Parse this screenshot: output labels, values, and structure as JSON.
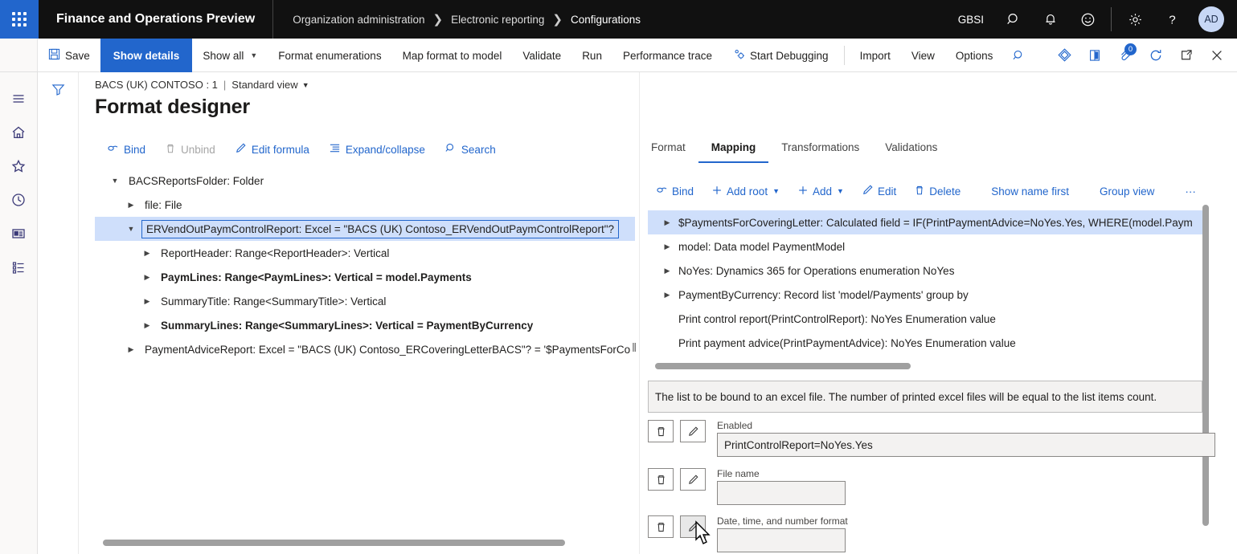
{
  "topbar": {
    "waffle_name": "app-launcher",
    "app_title": "Finance and Operations Preview",
    "breadcrumb": [
      {
        "label": "Organization administration"
      },
      {
        "label": "Electronic reporting"
      },
      {
        "label": "Configurations"
      }
    ],
    "company": "GBSI",
    "icons": [
      {
        "name": "search-icon",
        "glyph": "search"
      },
      {
        "name": "notifications-icon",
        "glyph": "bell"
      },
      {
        "name": "feedback-smiley-icon",
        "glyph": "smiley"
      },
      {
        "name": "settings-gear-icon",
        "glyph": "gear"
      },
      {
        "name": "help-icon",
        "glyph": "question"
      }
    ],
    "avatar_initials": "AD"
  },
  "actionbar": {
    "buttons": [
      {
        "label": "Save",
        "icon": "save-icon",
        "active": false,
        "caret": false
      },
      {
        "label": "Show details",
        "icon": "",
        "active": true,
        "caret": false
      },
      {
        "label": "Show all",
        "icon": "",
        "active": false,
        "caret": true
      },
      {
        "label": "Format enumerations",
        "icon": "",
        "active": false,
        "caret": false
      },
      {
        "label": "Map format to model",
        "icon": "",
        "active": false,
        "caret": false
      },
      {
        "label": "Validate",
        "icon": "",
        "active": false,
        "caret": false
      },
      {
        "label": "Run",
        "icon": "",
        "active": false,
        "caret": false
      },
      {
        "label": "Performance trace",
        "icon": "",
        "active": false,
        "caret": false
      },
      {
        "label": "Start Debugging",
        "icon": "debug-icon",
        "active": false,
        "caret": false
      }
    ],
    "buttons_right_group": [
      {
        "label": "Import"
      },
      {
        "label": "View"
      },
      {
        "label": "Options"
      }
    ],
    "right_icons": [
      {
        "name": "search-icon",
        "glyph": "search"
      },
      {
        "name": "personalize-icon",
        "glyph": "diamond"
      },
      {
        "name": "share-icon",
        "glyph": "book"
      },
      {
        "name": "attachments-icon",
        "glyph": "clip",
        "badge": "0"
      },
      {
        "name": "refresh-icon",
        "glyph": "refresh"
      },
      {
        "name": "open-in-new-window-icon",
        "glyph": "popout"
      },
      {
        "name": "close-icon",
        "glyph": "close"
      }
    ]
  },
  "rail": {
    "items": [
      {
        "name": "hamburger-menu-icon",
        "glyph": "menu"
      },
      {
        "name": "home-icon",
        "glyph": "home"
      },
      {
        "name": "favorites-star-icon",
        "glyph": "star"
      },
      {
        "name": "recent-clock-icon",
        "glyph": "clock"
      },
      {
        "name": "workspaces-icon",
        "glyph": "workspace"
      },
      {
        "name": "modules-list-icon",
        "glyph": "list"
      }
    ],
    "filter_icon": "filter-icon"
  },
  "pagehead": {
    "record": "BACS (UK) CONTOSO : 1",
    "separator": "|",
    "view": "Standard view",
    "title": "Format designer"
  },
  "left_toolbar": [
    {
      "label": "Bind",
      "icon": "bind-link-icon",
      "disabled": false
    },
    {
      "label": "Unbind",
      "icon": "unbind-trash-icon",
      "disabled": true
    },
    {
      "label": "Edit formula",
      "icon": "edit-pencil-icon",
      "disabled": false
    },
    {
      "label": "Expand/collapse",
      "icon": "expand-collapse-icon",
      "disabled": false
    },
    {
      "label": "Search",
      "icon": "search-icon",
      "disabled": false
    }
  ],
  "format_tree": [
    {
      "label": "BACSReportsFolder: Folder",
      "indent": 0,
      "twisty": "expanded",
      "bold": false,
      "selected": false
    },
    {
      "label": "file: File",
      "indent": 1,
      "twisty": "collapsed",
      "bold": false,
      "selected": false
    },
    {
      "label": "ERVendOutPaymControlReport: Excel = \"BACS (UK) Contoso_ERVendOutPaymControlReport\"?",
      "indent": 1,
      "twisty": "expanded",
      "bold": false,
      "selected": true
    },
    {
      "label": "ReportHeader: Range<ReportHeader>: Vertical",
      "indent": 2,
      "twisty": "collapsed",
      "bold": false,
      "selected": false
    },
    {
      "label": "PaymLines: Range<PaymLines>: Vertical = model.Payments",
      "indent": 2,
      "twisty": "collapsed",
      "bold": true,
      "selected": false
    },
    {
      "label": "SummaryTitle: Range<SummaryTitle>: Vertical",
      "indent": 2,
      "twisty": "collapsed",
      "bold": false,
      "selected": false
    },
    {
      "label": "SummaryLines: Range<SummaryLines>: Vertical = PaymentByCurrency",
      "indent": 2,
      "twisty": "collapsed",
      "bold": true,
      "selected": false
    },
    {
      "label": "PaymentAdviceReport: Excel = \"BACS (UK) Contoso_ERCoveringLetterBACS\"? = '$PaymentsForCo",
      "indent": 1,
      "twisty": "collapsed",
      "bold": false,
      "selected": false
    }
  ],
  "right_panel": {
    "tabs": [
      {
        "label": "Format",
        "active": false
      },
      {
        "label": "Mapping",
        "active": true
      },
      {
        "label": "Transformations",
        "active": false
      },
      {
        "label": "Validations",
        "active": false
      }
    ],
    "toolbar": [
      {
        "label": "Bind",
        "icon": "bind-link-icon",
        "caret": false
      },
      {
        "label": "Add root",
        "icon": "plus-icon",
        "caret": true
      },
      {
        "label": "Add",
        "icon": "plus-icon",
        "caret": true
      },
      {
        "label": "Edit",
        "icon": "edit-pencil-icon",
        "caret": false
      },
      {
        "label": "Delete",
        "icon": "delete-trash-icon",
        "caret": false
      },
      {
        "label": "Show name first",
        "icon": "",
        "caret": false
      },
      {
        "label": "Group view",
        "icon": "",
        "caret": false
      },
      {
        "label": "···",
        "icon": "more-options-icon",
        "caret": false
      }
    ],
    "tree": [
      {
        "label": "$PaymentsForCoveringLetter: Calculated field = IF(PrintPaymentAdvice=NoYes.Yes, WHERE(model.Paym",
        "twisty": "collapsed",
        "selected": true
      },
      {
        "label": "model: Data model PaymentModel",
        "twisty": "collapsed",
        "selected": false
      },
      {
        "label": "NoYes: Dynamics 365 for Operations enumeration NoYes",
        "twisty": "collapsed",
        "selected": false
      },
      {
        "label": "PaymentByCurrency: Record list 'model/Payments' group by",
        "twisty": "collapsed",
        "selected": false
      },
      {
        "label": "Print control report(PrintControlReport): NoYes Enumeration value",
        "twisty": "none",
        "selected": false
      },
      {
        "label": "Print payment advice(PrintPaymentAdvice): NoYes Enumeration value",
        "twisty": "none",
        "selected": false
      }
    ],
    "description": "The list to be bound to an excel file. The number of printed excel files will be equal to the list items count.",
    "fields": [
      {
        "label": "Enabled",
        "value": "PrintControlReport=NoYes.Yes",
        "width": "wide",
        "delete_icon": "delete-trash-icon",
        "edit_icon": "edit-pencil-icon",
        "hovered": false
      },
      {
        "label": "File name",
        "value": "",
        "width": "narrow",
        "delete_icon": "delete-trash-icon",
        "edit_icon": "edit-pencil-icon",
        "hovered": false
      },
      {
        "label": "Date, time, and number format",
        "value": "",
        "width": "narrow",
        "delete_icon": "delete-trash-icon",
        "edit_icon": "edit-pencil-icon",
        "hovered": true
      }
    ]
  },
  "colors": {
    "accent": "#2266cc",
    "topbar_bg": "#111111",
    "selection_bg": "#cfdffb",
    "field_bg": "#f3f2f1"
  }
}
